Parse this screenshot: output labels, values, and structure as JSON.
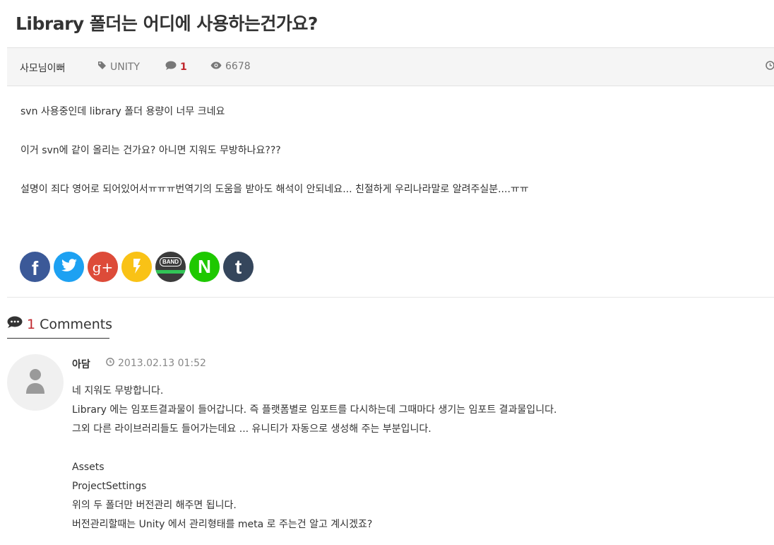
{
  "post": {
    "title": "Library 폴더는 어디에 사용하는건가요?",
    "author": "사모님이뻐",
    "tag": "UNITY",
    "comment_count": "1",
    "views": "6678",
    "body": [
      "svn 사용중인데 library 폴더 용량이 너무 크네요",
      "이거 svn에 같이 올리는 건가요? 아니면 지워도 무방하나요???",
      "설명이 죄다 영어로 되어있어서ㅠㅠㅠ번역기의 도움을 받아도 해석이 안되네요... 친절하게 우리나라말로 알려주실분....ㅠㅠ"
    ]
  },
  "share": {
    "facebook": "f",
    "google": "g+",
    "band": "BAND",
    "naver": "N",
    "tumblr": "t"
  },
  "comments": {
    "count": "1",
    "label": "Comments",
    "items": [
      {
        "author": "아담",
        "date": "2013.02.13 01:52",
        "lines": [
          "네 지워도 무방합니다.",
          "Library 에는 임포트결과물이 들어갑니다. 즉 플랫폼별로 임포트를 다시하는데 그때마다 생기는 임포트 결과물입니다.",
          "그외 다른 라이브러리들도 들어가는데요 ... 유니티가 자동으로 생성해 주는 부분입니다.",
          "",
          "Assets",
          "ProjectSettings",
          "위의 두 폴더만 버전관리 해주면 됩니다.",
          "버전관리할때는 Unity 에서 관리형태를 meta 로 주는건 알고 계시겠죠?"
        ]
      }
    ]
  },
  "colors": {
    "accent_red": "#c0272d",
    "facebook": "#3b5998",
    "twitter": "#1da1f2",
    "google": "#dd4b39",
    "kakaostory": "#f9c216",
    "band": "#3b3b3b",
    "naver": "#1ec800",
    "tumblr": "#35465c"
  },
  "icons": [
    "tag-icon",
    "comment-icon",
    "eye-icon",
    "clock-icon",
    "facebook-icon",
    "twitter-icon",
    "google-plus-icon",
    "kakaostory-icon",
    "band-icon",
    "naver-icon",
    "tumblr-icon",
    "user-icon"
  ]
}
